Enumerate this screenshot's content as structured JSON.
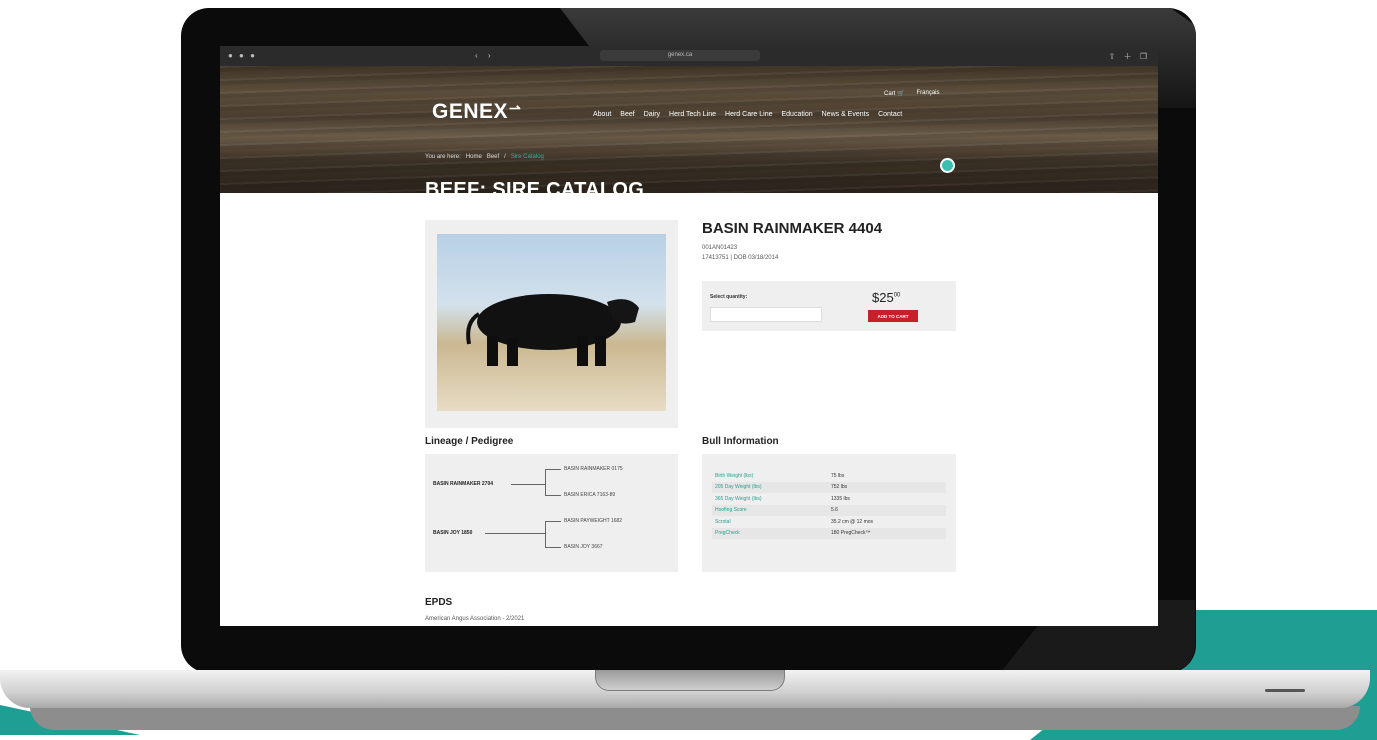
{
  "browser": {
    "url": "genex.ca",
    "window_controls": "● ● ●",
    "nav_icons": "‹ ›",
    "toolbar_icons": "⇧ ＋ ❐"
  },
  "header": {
    "logo": "GENEX",
    "logo_mark": "⇀",
    "nav": [
      "About",
      "Beef",
      "Dairy",
      "Herd Tech Line",
      "Herd Care Line",
      "Education",
      "News & Events",
      "Contact"
    ],
    "cart": "Cart 🛒",
    "language": "Français"
  },
  "breadcrumb": [
    "You are here:",
    "Home",
    "Beef",
    "/",
    "Sire Catalog"
  ],
  "page_title": "BEEF: SIRE CATALOG",
  "product": {
    "name": "BASIN RAINMAKER 4404",
    "code": "001AN01423",
    "registration": "17413751 | DOB 03/18/2014",
    "quantity_label": "Select quantity:",
    "quantity_value": "",
    "price_main": "$25",
    "price_cents": "00",
    "add_to_cart": "ADD TO CART"
  },
  "lineage": {
    "heading": "Lineage / Pedigree",
    "sire": "BASIN RAINMAKER 2704",
    "dam": "BASIN JOY 1850",
    "sire_sire": "BASIN RAINMAKER 0175",
    "sire_dam": "BASIN ERICA 7163-89",
    "dam_sire": "BASIN PAYWEIGHT 1682",
    "dam_dam": "BASIN JOY 3667"
  },
  "bull_info": {
    "heading": "Bull Information",
    "rows": [
      {
        "label": "Birth Weight (lbs)",
        "value": "75 lbs"
      },
      {
        "label": "205 Day Weight (lbs)",
        "value": "752 lbs"
      },
      {
        "label": "365 Day Weight (lbs)",
        "value": "1335 lbs"
      },
      {
        "label": "Hoofing Score",
        "value": "5.6"
      },
      {
        "label": "Scrotal",
        "value": "35.2 cm @ 12 mos"
      },
      {
        "label": "PregCheck",
        "value": "180 PregCheck™"
      }
    ]
  },
  "epds": {
    "heading": "EPDS",
    "association": "American Angus Association - 2/2021"
  }
}
